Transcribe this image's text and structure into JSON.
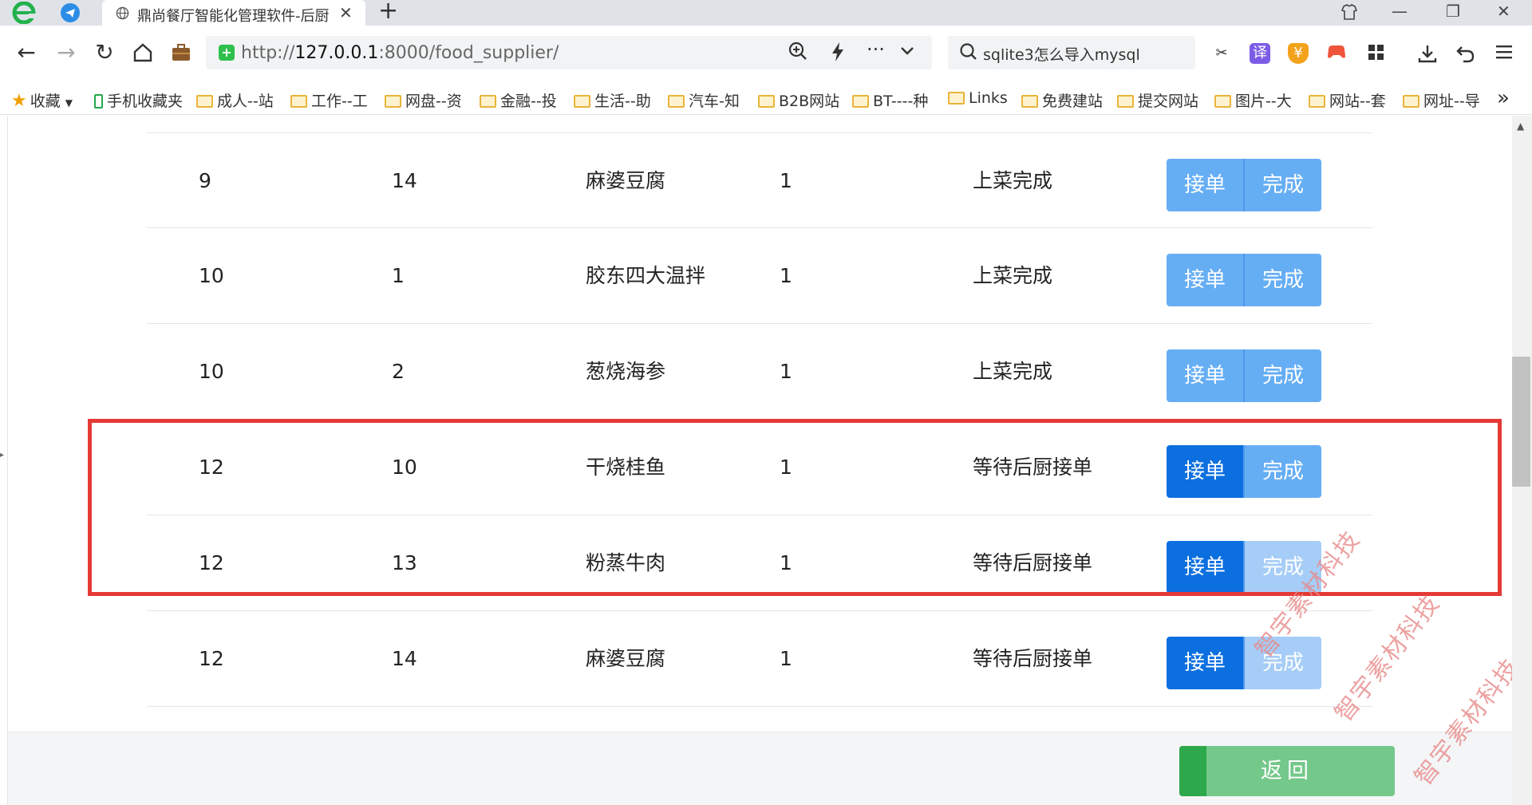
{
  "browser": {
    "tab_title": "鼎尚餐厅智能化管理软件-后厨",
    "tab_close": "✕",
    "new_tab": "+",
    "url_host": "127.0.0.1",
    "url_prefix": "http://",
    "url_suffix": ":8000/food_supplier/",
    "search_text": "sqlite3怎么导入mysql",
    "bookmarks": [
      {
        "label": "收藏",
        "type": "star"
      },
      {
        "label": "手机收藏夹",
        "type": "phone"
      },
      {
        "label": "成人--站",
        "type": "folder"
      },
      {
        "label": "工作--工",
        "type": "folder"
      },
      {
        "label": "网盘--资",
        "type": "folder"
      },
      {
        "label": "金融--投",
        "type": "folder"
      },
      {
        "label": "生活--助",
        "type": "folder"
      },
      {
        "label": "汽车-知",
        "type": "folder"
      },
      {
        "label": "B2B网站",
        "type": "folder"
      },
      {
        "label": "BT----种",
        "type": "folder"
      },
      {
        "label": "Links",
        "type": "folder"
      },
      {
        "label": "免费建站",
        "type": "folder"
      },
      {
        "label": "提交网站",
        "type": "folder"
      },
      {
        "label": "图片--大",
        "type": "folder"
      },
      {
        "label": "网站--套",
        "type": "folder"
      },
      {
        "label": "网址--导",
        "type": "folder"
      }
    ],
    "bookmarks_more": "»",
    "extension_translate": "译",
    "extension_coin": "¥"
  },
  "orders": [
    {
      "table": "9",
      "dish_id": "14",
      "dish": "麻婆豆腐",
      "qty": "1",
      "status": "上菜完成",
      "style": "done"
    },
    {
      "table": "10",
      "dish_id": "1",
      "dish": "胶东四大温拌",
      "qty": "1",
      "status": "上菜完成",
      "style": "done"
    },
    {
      "table": "10",
      "dish_id": "2",
      "dish": "葱烧海参",
      "qty": "1",
      "status": "上菜完成",
      "style": "done"
    },
    {
      "table": "12",
      "dish_id": "10",
      "dish": "干烧桂鱼",
      "qty": "1",
      "status": "等待后厨接单",
      "style": "pending"
    },
    {
      "table": "12",
      "dish_id": "13",
      "dish": "粉蒸牛肉",
      "qty": "1",
      "status": "等待后厨接单",
      "style": "pending"
    },
    {
      "table": "12",
      "dish_id": "14",
      "dish": "麻婆豆腐",
      "qty": "1",
      "status": "等待后厨接单",
      "style": "pending"
    }
  ],
  "buttons": {
    "accept_label": "接单",
    "complete_label": "完成",
    "return_label": "返回"
  },
  "watermark": "智宇素材科技",
  "colors": {
    "button_light": "#66aef4",
    "button_strong": "#0c6fe0",
    "highlight": "#e53935",
    "return_green": "#74c88a"
  }
}
